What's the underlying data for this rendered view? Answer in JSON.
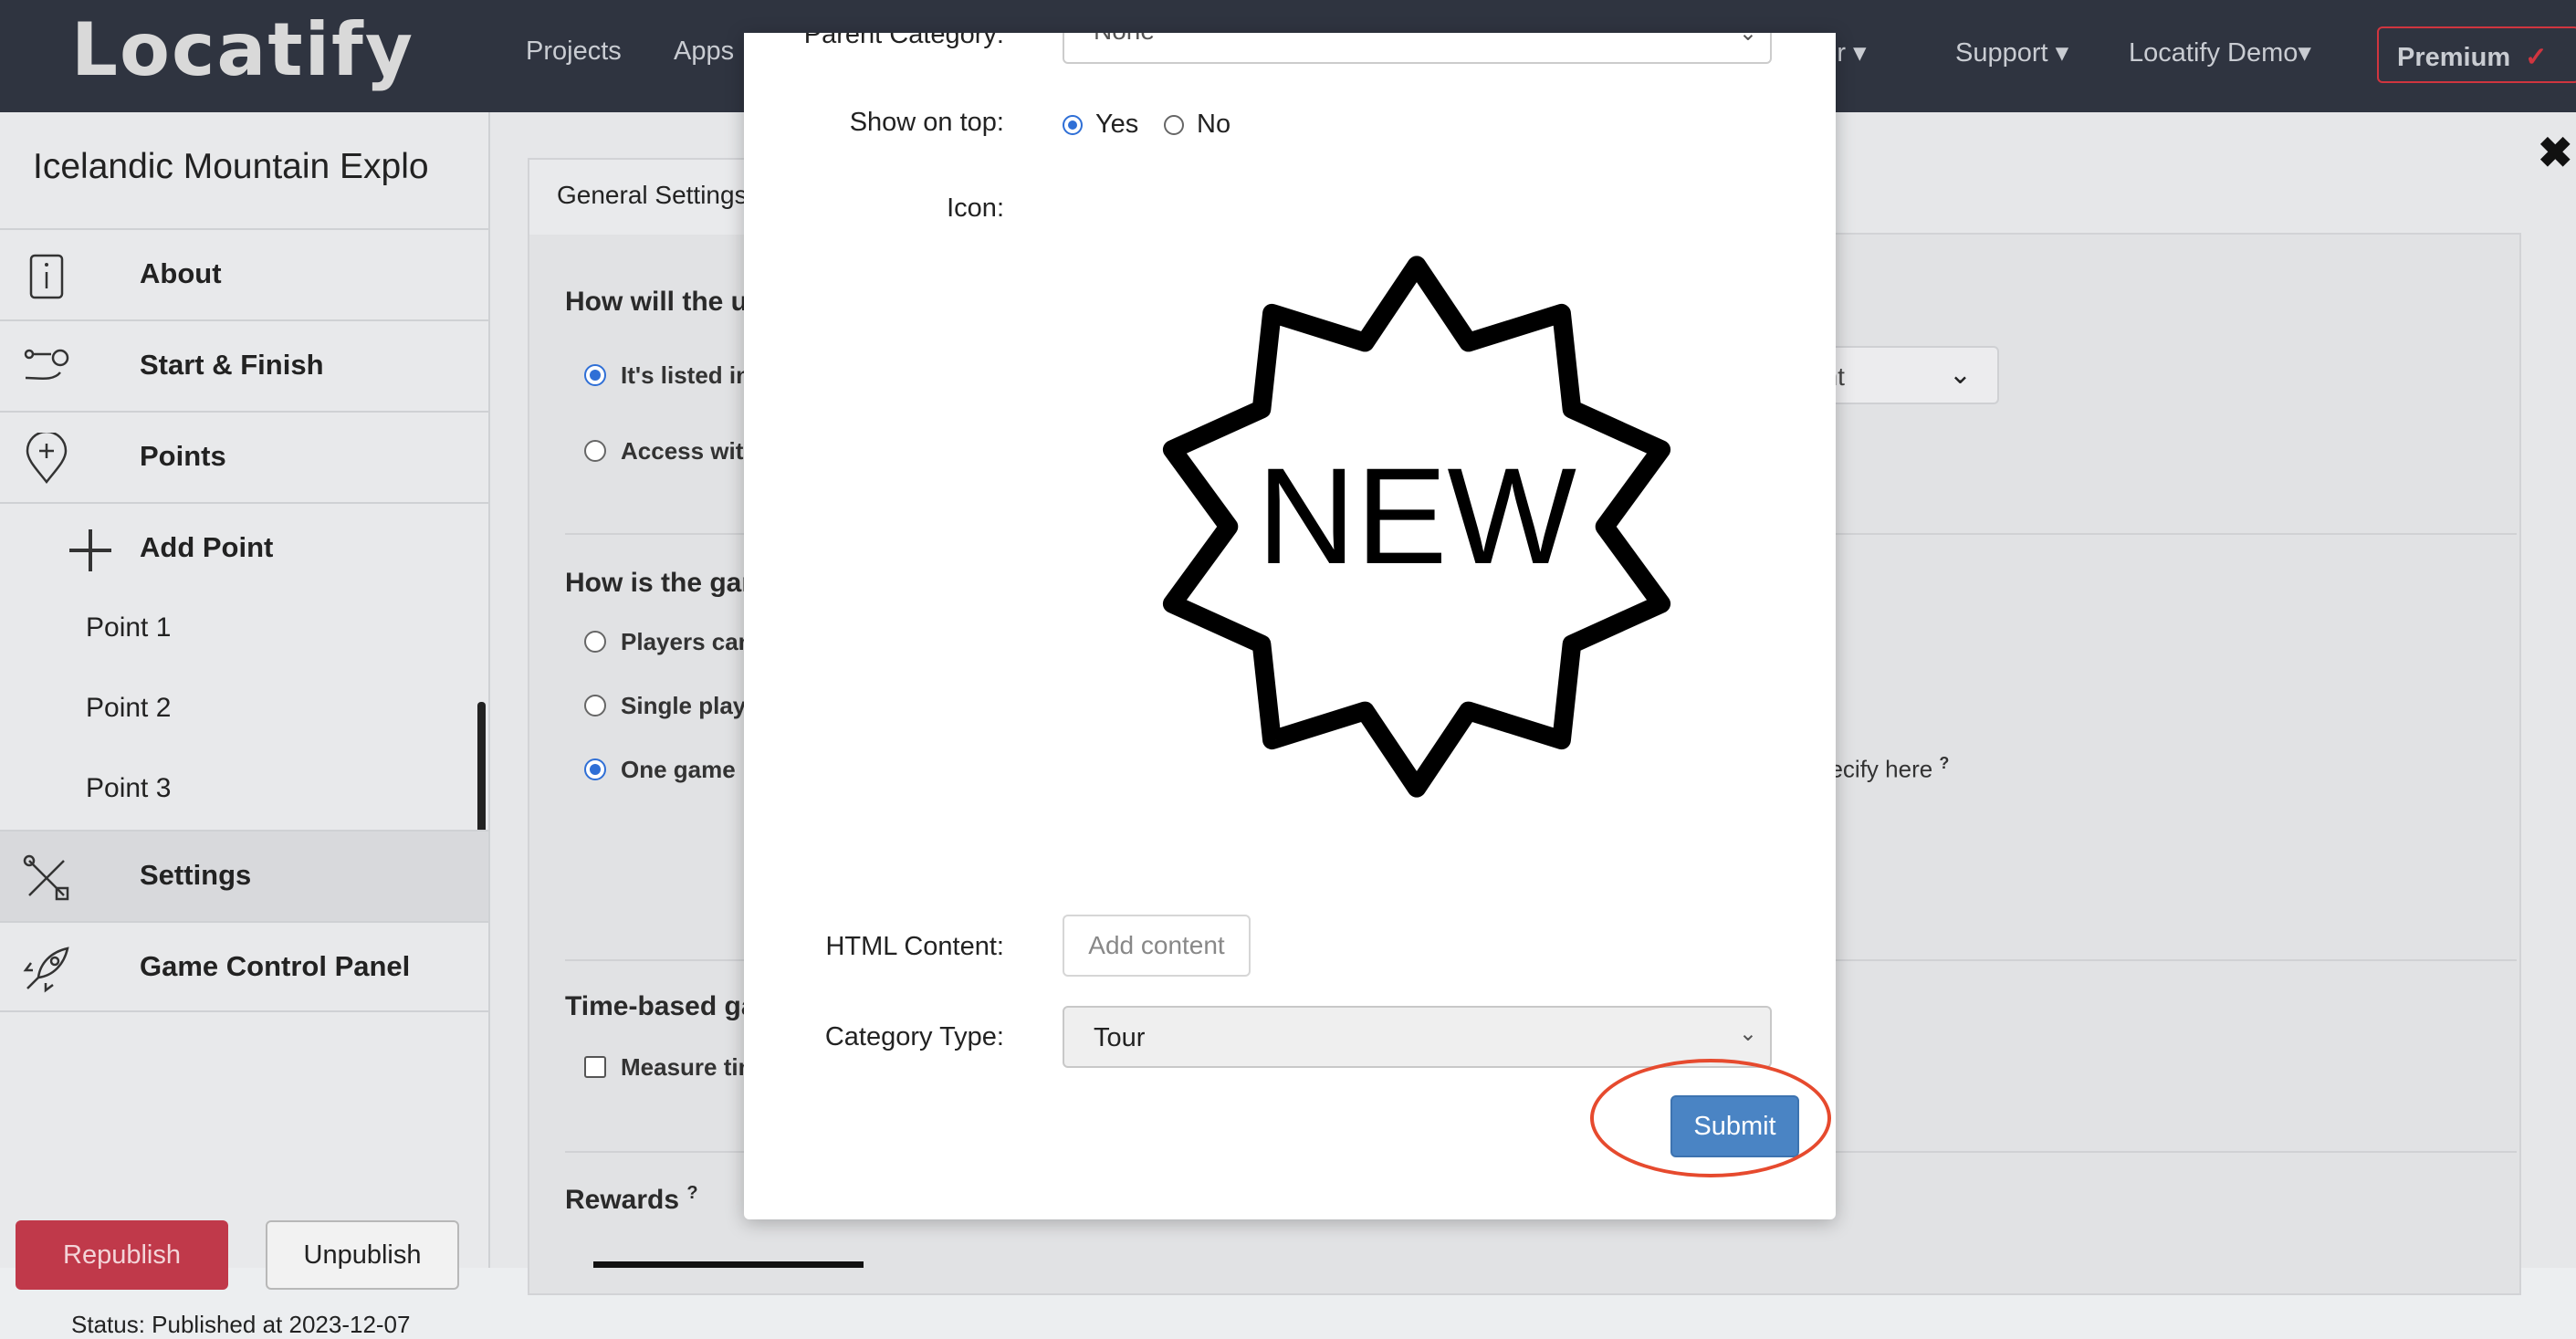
{
  "app": {
    "logo": "Locatify",
    "nav": [
      "Projects",
      "Apps",
      "ator ▾",
      "Support ▾",
      "Locatify Demo▾"
    ],
    "premium_label": "Premium",
    "premium_check": "✓"
  },
  "sidebar": {
    "project_title": "Icelandic Mountain Explo",
    "items": [
      {
        "label": "About",
        "icon": "info-icon"
      },
      {
        "label": "Start & Finish",
        "icon": "route-icon"
      },
      {
        "label": "Points",
        "icon": "map-pin-icon"
      },
      {
        "label": "Add Point",
        "icon": "plus-icon"
      }
    ],
    "points": [
      "Point 1",
      "Point 2",
      "Point 3"
    ],
    "settings_label": "Settings",
    "control_label": "Game Control Panel",
    "republish": "Republish",
    "unpublish": "Unpublish",
    "status": "Status: Published at 2023-12-07"
  },
  "background": {
    "tab": "General Settings",
    "q1": "How will the us",
    "q1_opt1": "It's listed in",
    "q1_opt2": "Access wit",
    "select_partial": "unt",
    "q2": "How is the gan",
    "q2_opt1": "Players can",
    "q2_opt2": "Single play",
    "q2_opt3": "One game",
    "specify": "pecify here",
    "specify_sup": "?",
    "time_section": "Time-based ga",
    "measure": "Measure tin",
    "rewards": "Rewards",
    "rewards_sup": "?",
    "close": "✖"
  },
  "modal": {
    "parent_category_label": "Parent Category:",
    "parent_category_value": "None",
    "show_on_top_label": "Show on top:",
    "yes": "Yes",
    "no": "No",
    "icon_label": "Icon:",
    "icon_text": "NEW",
    "html_content_label": "HTML Content:",
    "add_content": "Add content",
    "category_type_label": "Category Type:",
    "category_type_value": "Tour",
    "submit": "Submit"
  }
}
